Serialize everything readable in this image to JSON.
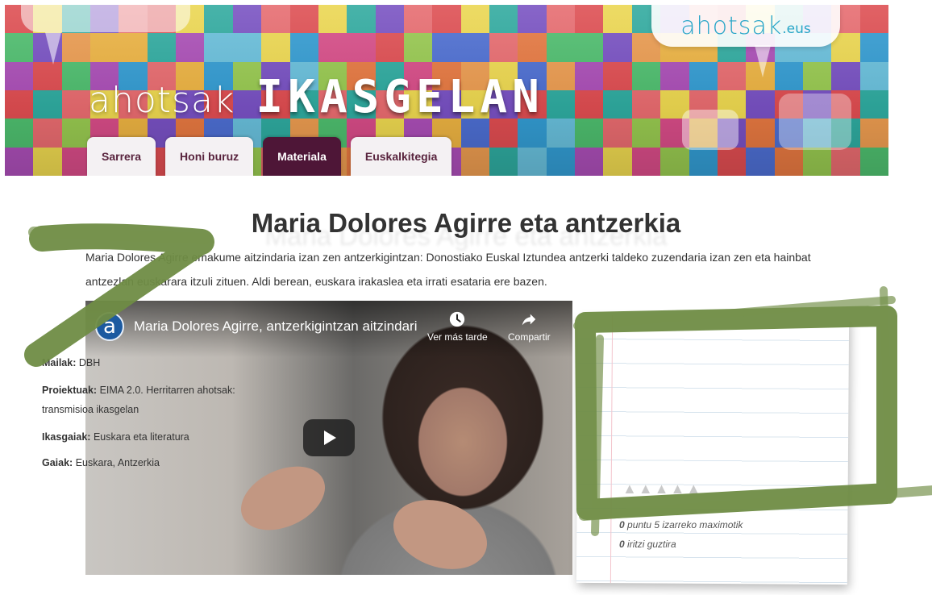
{
  "header": {
    "site_logo_main": "ahotsak",
    "site_logo_tld": ".eus",
    "brand_prefix": "ahotsak",
    "brand_name": "IKASGELAN",
    "tabs": [
      {
        "label": "Sarrera",
        "active": false
      },
      {
        "label": "Honi buruz",
        "active": false
      },
      {
        "label": "Materiala",
        "active": true
      },
      {
        "label": "Euskalkitegia",
        "active": false
      }
    ]
  },
  "page": {
    "title": "Maria Dolores Agirre eta antzerkia",
    "intro_line1": "Maria Dolores Agirre emakume aitzindaria izan zen antzerkigintzan: Donostiako Euskal Iztundea antzerki taldeko zuzendaria izan zen eta hainbat",
    "intro_line2": "antzezlan euskarara itzuli zituen. Aldi berean, euskara irakaslea eta irrati esataria ere bazen."
  },
  "video": {
    "channel_letter": "a",
    "title": "Maria Dolores Agirre, antzerkigintzan aitzindari",
    "watch_later": "Ver más tarde",
    "share": "Compartir"
  },
  "info": {
    "mailak_label": "Mailak:",
    "mailak_value": "DBH",
    "proiektuak_label": "Proiektuak:",
    "proiektuak_value": "EIMA 2.0. Herritarren ahotsak: transmisioa ikasgelan",
    "ikasgaiak_label": "Ikasgaiak:",
    "ikasgaiak_value": "Euskara eta literatura",
    "gaiak_label": "Gaiak:",
    "gaiak_value": "Euskara, Antzerkia",
    "stars_filled": 0,
    "stars_total": 5,
    "rating_points": "0",
    "rating_points_text": "puntu 5 izarreko maximotik",
    "rating_count": "0",
    "rating_count_text": "iritzi guztira"
  },
  "colors": {
    "tab_active": "#4e1637",
    "tab_text": "#58233d",
    "logo_blue": "#27a5c8",
    "annotation_green": "#6f8d45"
  }
}
